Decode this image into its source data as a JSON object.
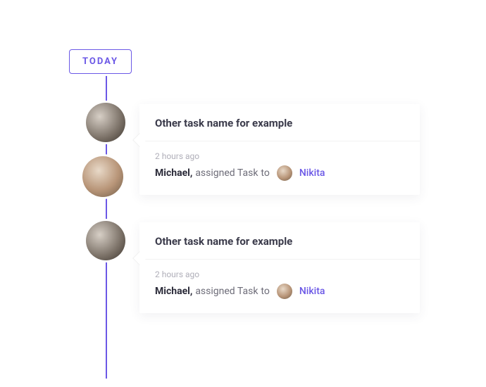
{
  "badge": {
    "label": "TODAY"
  },
  "colors": {
    "accent": "#6b58e6"
  },
  "items": [
    {
      "title": "Other task name for example",
      "timestamp": "2 hours ago",
      "actor": "Michael,",
      "action_prefix": "assigned Task",
      "action_suffix": "to",
      "assignee": "Nikita"
    },
    {
      "title": "Other task name for example",
      "timestamp": "2 hours ago",
      "actor": "Michael,",
      "action_prefix": "assigned Task",
      "action_suffix": "to",
      "assignee": "Nikita"
    }
  ]
}
